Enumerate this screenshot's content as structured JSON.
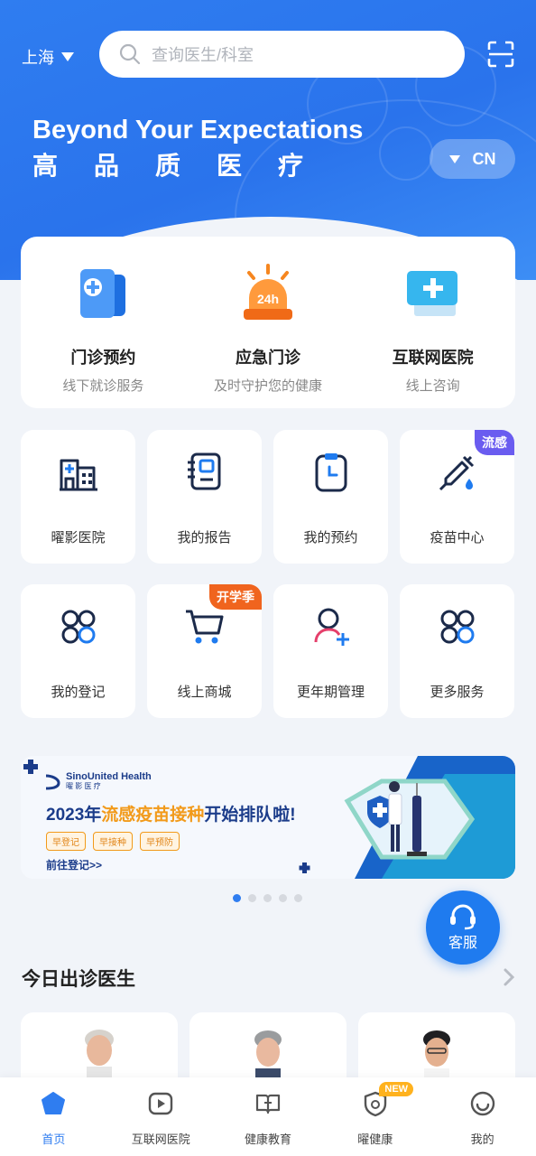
{
  "header": {
    "city": "上海",
    "search_placeholder": "查询医生/科室",
    "slogan_en": "Beyond Your Expectations",
    "slogan_cn": "高品质医疗",
    "language": "CN"
  },
  "main_services": [
    {
      "title": "门诊预约",
      "subtitle": "线下就诊服务",
      "icon": "clinic-appointment-icon"
    },
    {
      "title": "应急门诊",
      "subtitle": "及时守护您的健康",
      "icon": "emergency-24h-icon"
    },
    {
      "title": "互联网医院",
      "subtitle": "线上咨询",
      "icon": "online-hospital-icon"
    }
  ],
  "grid_row1": [
    {
      "label": "曜影医院",
      "icon": "hospital-building-icon",
      "tag": ""
    },
    {
      "label": "我的报告",
      "icon": "report-icon",
      "tag": ""
    },
    {
      "label": "我的预约",
      "icon": "appointment-clipboard-icon",
      "tag": ""
    },
    {
      "label": "疫苗中心",
      "icon": "vaccine-syringe-icon",
      "tag": "流感"
    }
  ],
  "grid_row2": [
    {
      "label": "我的登记",
      "icon": "registration-grid-icon",
      "tag": ""
    },
    {
      "label": "线上商城",
      "icon": "shopping-cart-icon",
      "tag": "开学季"
    },
    {
      "label": "更年期管理",
      "icon": "menopause-care-icon",
      "tag": ""
    },
    {
      "label": "更多服务",
      "icon": "more-services-icon",
      "tag": ""
    }
  ],
  "banner": {
    "brand_en": "SinoUnited Health",
    "brand_cn": "曜 影 医 疗",
    "headline_year": "2023年",
    "headline_highlight": "流感疫苗接种",
    "headline_rest": "开始排队啦!",
    "pills": [
      "早登记",
      "早接种",
      "早预防"
    ],
    "link": "前往登记>>",
    "page_count": 5,
    "active_page": 1
  },
  "service_button": {
    "label": "客服",
    "icon": "headset-icon"
  },
  "doctors_section": {
    "title": "今日出诊医生"
  },
  "tabbar": [
    {
      "label": "首页",
      "icon": "home-pentagon-icon",
      "active": true
    },
    {
      "label": "互联网医院",
      "icon": "video-play-icon",
      "active": false
    },
    {
      "label": "健康教育",
      "icon": "book-plus-icon",
      "active": false
    },
    {
      "label": "曜健康",
      "icon": "health-badge-icon",
      "active": false,
      "badge": "NEW"
    },
    {
      "label": "我的",
      "icon": "smile-profile-icon",
      "active": false
    }
  ],
  "colors": {
    "primary": "#2f7df0",
    "tag_orange": "#f0641e",
    "tag_purple": "#6a5cf0",
    "banner_highlight": "#f29a1a"
  }
}
